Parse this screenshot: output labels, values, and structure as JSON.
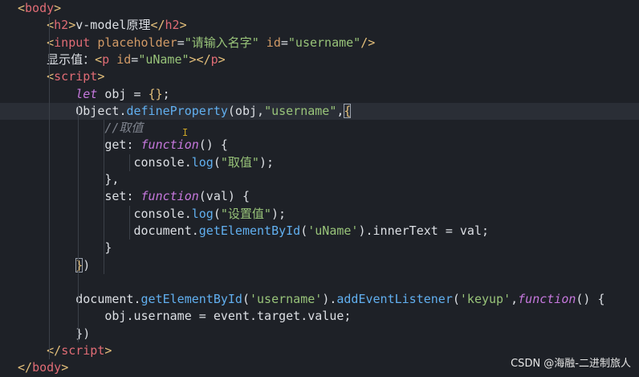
{
  "editor": {
    "lines": [
      {
        "segments": [
          {
            "t": "<",
            "c": "tag-p"
          },
          {
            "t": "body",
            "c": "tag"
          },
          {
            "t": ">",
            "c": "tag-p"
          }
        ]
      },
      {
        "segments": [
          {
            "t": "    ",
            "c": "txt"
          },
          {
            "t": "<",
            "c": "tag-p"
          },
          {
            "t": "h2",
            "c": "tag"
          },
          {
            "t": ">",
            "c": "tag-p"
          },
          {
            "t": "v-model原理",
            "c": "txt"
          },
          {
            "t": "</",
            "c": "tag-p"
          },
          {
            "t": "h2",
            "c": "tag"
          },
          {
            "t": ">",
            "c": "tag-p"
          }
        ]
      },
      {
        "segments": [
          {
            "t": "    ",
            "c": "txt"
          },
          {
            "t": "<",
            "c": "tag-p"
          },
          {
            "t": "input",
            "c": "tag"
          },
          {
            "t": " placeholder",
            "c": "attr"
          },
          {
            "t": "=",
            "c": "txt"
          },
          {
            "t": "\"请输入名字\"",
            "c": "str"
          },
          {
            "t": " id",
            "c": "attr"
          },
          {
            "t": "=",
            "c": "txt"
          },
          {
            "t": "\"username\"",
            "c": "str"
          },
          {
            "t": "/>",
            "c": "tag-p"
          }
        ]
      },
      {
        "segments": [
          {
            "t": "    显示值：",
            "c": "txt"
          },
          {
            "t": "<",
            "c": "tag-p"
          },
          {
            "t": "p",
            "c": "tag"
          },
          {
            "t": " id",
            "c": "attr"
          },
          {
            "t": "=",
            "c": "txt"
          },
          {
            "t": "\"uName\"",
            "c": "str"
          },
          {
            "t": "></",
            "c": "tag-p"
          },
          {
            "t": "p",
            "c": "tag"
          },
          {
            "t": ">",
            "c": "tag-p"
          }
        ]
      },
      {
        "segments": [
          {
            "t": "    ",
            "c": "txt"
          },
          {
            "t": "<",
            "c": "tag-p"
          },
          {
            "t": "script",
            "c": "tag"
          },
          {
            "t": ">",
            "c": "tag-p"
          }
        ]
      },
      {
        "segments": [
          {
            "t": "        ",
            "c": "txt"
          },
          {
            "t": "let",
            "c": "kw"
          },
          {
            "t": " obj = ",
            "c": "txt"
          },
          {
            "t": "{}",
            "c": "brace-y"
          },
          {
            "t": ";",
            "c": "txt"
          }
        ]
      },
      {
        "active": true,
        "segments": [
          {
            "t": "        Object",
            "c": "txt"
          },
          {
            "t": ".",
            "c": "txt"
          },
          {
            "t": "defineProperty",
            "c": "fn"
          },
          {
            "t": "(obj,",
            "c": "txt"
          },
          {
            "t": "\"username\"",
            "c": "str"
          },
          {
            "t": ",",
            "c": "txt"
          },
          {
            "t": "{",
            "c": "brace-y bracket-hl"
          }
        ]
      },
      {
        "segments": [
          {
            "t": "            ",
            "c": "txt"
          },
          {
            "t": "//取值",
            "c": "cmt"
          }
        ]
      },
      {
        "segments": [
          {
            "t": "            get: ",
            "c": "txt"
          },
          {
            "t": "function",
            "c": "kw"
          },
          {
            "t": "() {",
            "c": "txt"
          }
        ]
      },
      {
        "segments": [
          {
            "t": "                console",
            "c": "txt"
          },
          {
            "t": ".",
            "c": "txt"
          },
          {
            "t": "log",
            "c": "fn"
          },
          {
            "t": "(",
            "c": "txt"
          },
          {
            "t": "\"取值\"",
            "c": "str"
          },
          {
            "t": ");",
            "c": "txt"
          }
        ]
      },
      {
        "segments": [
          {
            "t": "            },",
            "c": "txt"
          }
        ]
      },
      {
        "segments": [
          {
            "t": "            set: ",
            "c": "txt"
          },
          {
            "t": "function",
            "c": "kw"
          },
          {
            "t": "(val) {",
            "c": "txt"
          }
        ]
      },
      {
        "segments": [
          {
            "t": "                console",
            "c": "txt"
          },
          {
            "t": ".",
            "c": "txt"
          },
          {
            "t": "log",
            "c": "fn"
          },
          {
            "t": "(",
            "c": "txt"
          },
          {
            "t": "\"设置值\"",
            "c": "str"
          },
          {
            "t": ");",
            "c": "txt"
          }
        ]
      },
      {
        "segments": [
          {
            "t": "                document",
            "c": "txt"
          },
          {
            "t": ".",
            "c": "txt"
          },
          {
            "t": "getElementById",
            "c": "fn"
          },
          {
            "t": "(",
            "c": "txt"
          },
          {
            "t": "'uName'",
            "c": "str"
          },
          {
            "t": ").innerText = val;",
            "c": "txt"
          }
        ]
      },
      {
        "segments": [
          {
            "t": "            }",
            "c": "txt"
          }
        ]
      },
      {
        "segments": [
          {
            "t": "        ",
            "c": "txt"
          },
          {
            "t": "}",
            "c": "brace-y bracket-hl"
          },
          {
            "t": ")",
            "c": "txt"
          }
        ]
      },
      {
        "segments": [
          {
            "t": "",
            "c": "txt"
          }
        ]
      },
      {
        "segments": [
          {
            "t": "        document",
            "c": "txt"
          },
          {
            "t": ".",
            "c": "txt"
          },
          {
            "t": "getElementById",
            "c": "fn"
          },
          {
            "t": "(",
            "c": "txt"
          },
          {
            "t": "'username'",
            "c": "str"
          },
          {
            "t": ").",
            "c": "txt"
          },
          {
            "t": "addEventListener",
            "c": "fn"
          },
          {
            "t": "(",
            "c": "txt"
          },
          {
            "t": "'keyup'",
            "c": "str"
          },
          {
            "t": ",",
            "c": "txt"
          },
          {
            "t": "function",
            "c": "kw"
          },
          {
            "t": "() {",
            "c": "txt"
          }
        ]
      },
      {
        "segments": [
          {
            "t": "            obj.username = event.target.value;",
            "c": "txt"
          }
        ]
      },
      {
        "segments": [
          {
            "t": "        })",
            "c": "txt"
          }
        ]
      },
      {
        "segments": [
          {
            "t": "    ",
            "c": "txt"
          },
          {
            "t": "</",
            "c": "tag-p"
          },
          {
            "t": "script",
            "c": "tag"
          },
          {
            "t": ">",
            "c": "tag-p"
          }
        ]
      },
      {
        "segments": [
          {
            "t": "</",
            "c": "tag-p"
          },
          {
            "t": "body",
            "c": "tag"
          },
          {
            "t": ">",
            "c": "tag-p"
          }
        ]
      }
    ]
  },
  "watermark": {
    "text": "CSDN @海融-二进制旅人"
  }
}
